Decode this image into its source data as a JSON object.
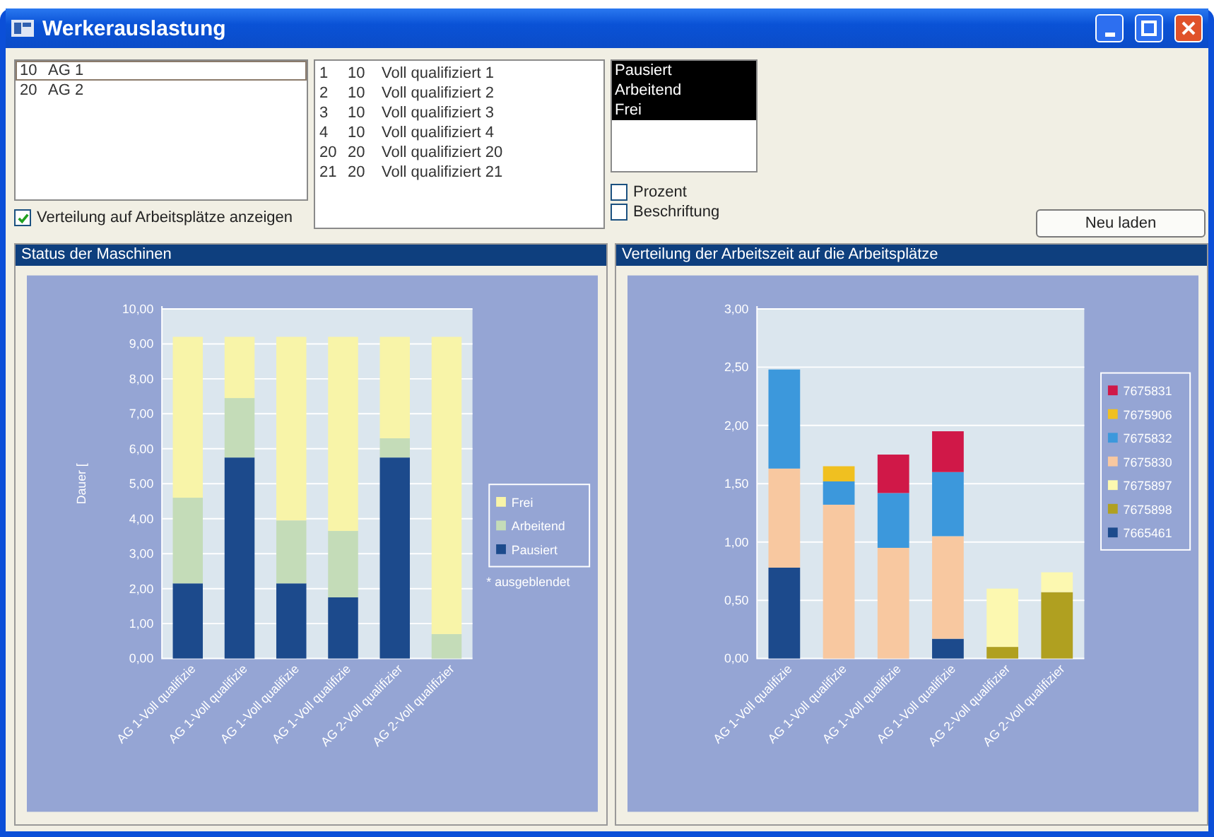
{
  "window": {
    "title": "Werkerauslastung"
  },
  "workgroups": {
    "rows": [
      {
        "cells": [
          "10",
          "AG 1"
        ],
        "selected": true
      },
      {
        "cells": [
          "20",
          "AG 2"
        ],
        "selected": false
      }
    ]
  },
  "show_distribution": {
    "label": "Verteilung auf Arbeitsplätze anzeigen",
    "checked": true
  },
  "workers": {
    "rows": [
      {
        "cells": [
          "1",
          "10",
          "Voll qualifiziert 1"
        ]
      },
      {
        "cells": [
          "2",
          "10",
          "Voll qualifiziert 2"
        ]
      },
      {
        "cells": [
          "3",
          "10",
          "Voll qualifiziert 3"
        ]
      },
      {
        "cells": [
          "4",
          "10",
          "Voll qualifiziert 4"
        ]
      },
      {
        "cells": [
          "20",
          "20",
          "Voll qualifiziert 20"
        ]
      },
      {
        "cells": [
          "21",
          "20",
          "Voll qualifiziert 21"
        ]
      }
    ]
  },
  "status_list": {
    "items": [
      {
        "label": "Pausiert",
        "selected": true
      },
      {
        "label": "Arbeitend",
        "selected": true
      },
      {
        "label": "Frei",
        "selected": true
      }
    ]
  },
  "percent": {
    "label": "Prozent",
    "checked": false
  },
  "captions": {
    "label": "Beschriftung",
    "checked": false
  },
  "reload_button": "Neu laden",
  "machine_panel": {
    "title": "Status der Maschinen",
    "note": "* ausgeblendet",
    "chart_data": {
      "type": "bar",
      "stacked": true,
      "grid": true,
      "legend": true,
      "ylabel": "Dauer [",
      "categories": [
        "AG 1-Voll qualifizie",
        "AG 1-Voll qualifizie",
        "AG 1-Voll qualifizie",
        "AG 1-Voll qualifizie",
        "AG 2-Voll qualifizier",
        "AG 2-Voll qualifizier"
      ],
      "ylim": [
        0,
        10
      ],
      "yticks": [
        {
          "value": 0,
          "label": "0,00"
        },
        {
          "value": 1,
          "label": "1,00"
        },
        {
          "value": 2,
          "label": "2,00"
        },
        {
          "value": 3,
          "label": "3,00"
        },
        {
          "value": 4,
          "label": "4,00"
        },
        {
          "value": 5,
          "label": "5,00"
        },
        {
          "value": 6,
          "label": "6,00"
        },
        {
          "value": 7,
          "label": "7,00"
        },
        {
          "value": 8,
          "label": "8,00"
        },
        {
          "value": 9,
          "label": "9,00"
        },
        {
          "value": 10,
          "label": "10,00"
        }
      ],
      "series": [
        {
          "name": "Pausiert",
          "color": "#1c4a8c",
          "values": [
            2.15,
            5.75,
            2.15,
            1.75,
            5.75,
            0
          ]
        },
        {
          "name": "Arbeitend",
          "color": "#c4dcb8",
          "values": [
            2.45,
            1.7,
            1.8,
            1.9,
            0.55,
            0.7
          ]
        },
        {
          "name": "Frei",
          "color": "#f8f4a8",
          "values": [
            4.6,
            1.75,
            5.25,
            5.55,
            2.9,
            8.5
          ]
        }
      ]
    }
  },
  "workplace_panel": {
    "title": "Verteilung der Arbeitszeit auf die Arbeitsplätze",
    "chart_data": {
      "type": "bar",
      "stacked": true,
      "grid": true,
      "legend": true,
      "categories": [
        "AG 1-Voll qualifizie",
        "AG 1-Voll qualifizie",
        "AG 1-Voll qualifizie",
        "AG 1-Voll qualifizie",
        "AG 2-Voll qualifizier",
        "AG 2-Voll qualifizier"
      ],
      "ylim": [
        0,
        3
      ],
      "yticks": [
        {
          "value": 0,
          "label": "0,00"
        },
        {
          "value": 0.5,
          "label": "0,50"
        },
        {
          "value": 1,
          "label": "1,00"
        },
        {
          "value": 1.5,
          "label": "1,50"
        },
        {
          "value": 2,
          "label": "2,00"
        },
        {
          "value": 2.5,
          "label": "2,50"
        },
        {
          "value": 3,
          "label": "3,00"
        }
      ],
      "series": [
        {
          "name": "7665461",
          "color": "#1c4a8c",
          "values": [
            0.78,
            0,
            0,
            0.17,
            0,
            0
          ]
        },
        {
          "name": "7675898",
          "color": "#b0a020",
          "values": [
            0,
            0,
            0,
            0,
            0.1,
            0.57
          ]
        },
        {
          "name": "7675897",
          "color": "#fcf8b0",
          "values": [
            0,
            0,
            0,
            0,
            0.5,
            0.17
          ]
        },
        {
          "name": "7675830",
          "color": "#f8c8a0",
          "values": [
            0.85,
            1.32,
            0.95,
            0.88,
            0,
            0
          ]
        },
        {
          "name": "7675832",
          "color": "#3c98dc",
          "values": [
            0.85,
            0.2,
            0.47,
            0.55,
            0,
            0
          ]
        },
        {
          "name": "7675906",
          "color": "#f0c020",
          "values": [
            0,
            0.13,
            0,
            0,
            0,
            0
          ]
        },
        {
          "name": "7675831",
          "color": "#d01848",
          "values": [
            0,
            0,
            0.33,
            0.35,
            0,
            0
          ]
        }
      ]
    }
  }
}
